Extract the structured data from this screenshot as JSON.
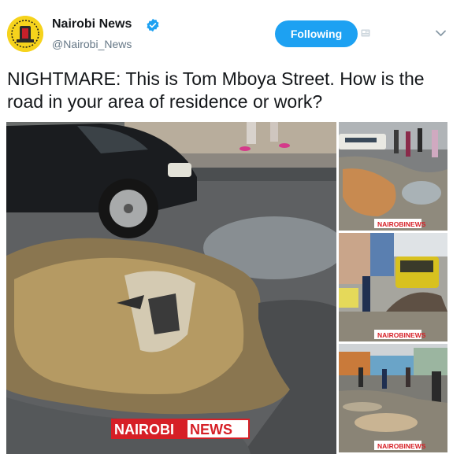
{
  "account": {
    "name": "Nairobi News",
    "handle": "@Nairobi_News",
    "follow_label": "Following"
  },
  "tweet": {
    "text": "NIGHTMARE: This is Tom Mboya Street. How is the road in your area of residence or work?"
  },
  "watermark": {
    "part1": "NAIROBI",
    "part2": "NEWS",
    "thumb_text": "NAIROBINEWS"
  },
  "icons": {
    "verified": "verified-badge-icon",
    "ext": "media-card-icon",
    "more": "chevron-down-icon"
  },
  "colors": {
    "accent": "#1da1f2",
    "avatar_bg": "#f6d31c",
    "watermark_red": "#d61f26"
  }
}
